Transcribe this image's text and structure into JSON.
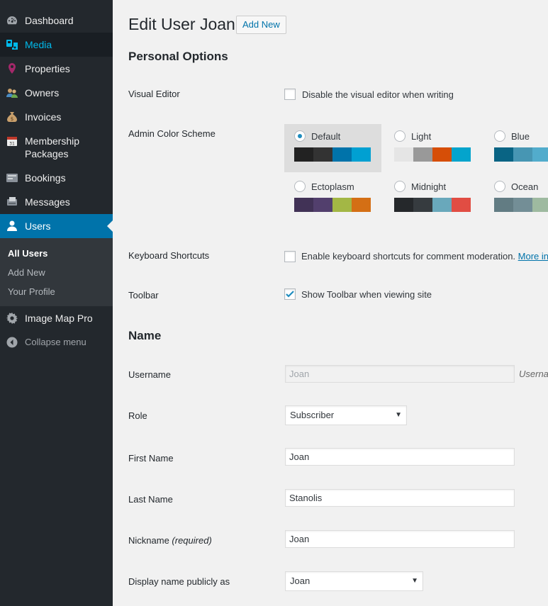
{
  "sidebar": {
    "items": [
      {
        "label": "Dashboard",
        "icon": "dashboard-icon"
      },
      {
        "label": "Media",
        "icon": "media-icon"
      },
      {
        "label": "Properties",
        "icon": "map-pin-icon"
      },
      {
        "label": "Owners",
        "icon": "owners-icon"
      },
      {
        "label": "Invoices",
        "icon": "money-bag-icon"
      },
      {
        "label": "Membership Packages",
        "icon": "calendar-icon"
      },
      {
        "label": "Bookings",
        "icon": "bookings-icon"
      },
      {
        "label": "Messages",
        "icon": "messages-icon"
      },
      {
        "label": "Users",
        "icon": "user-icon"
      }
    ],
    "submenu": [
      "All Users",
      "Add New",
      "Your Profile"
    ],
    "image_map_pro": "Image Map Pro",
    "collapse": "Collapse menu"
  },
  "header": {
    "title": "Edit User Joan",
    "add_new": "Add New"
  },
  "personal_options": {
    "heading": "Personal Options",
    "visual_editor_label": "Visual Editor",
    "visual_editor_checkbox": "Disable the visual editor when writing",
    "color_scheme_label": "Admin Color Scheme",
    "schemes": [
      {
        "name": "Default",
        "selected": true,
        "colors": [
          "#222222",
          "#333333",
          "#0073aa",
          "#00a0d2"
        ]
      },
      {
        "name": "Light",
        "selected": false,
        "colors": [
          "#e5e5e5",
          "#999999",
          "#d64e07",
          "#04a4cc"
        ]
      },
      {
        "name": "Blue",
        "selected": false,
        "colors": [
          "#096484",
          "#4796b3",
          "#52accc",
          "#74B6CE"
        ]
      },
      {
        "name": "Ectoplasm",
        "selected": false,
        "colors": [
          "#413256",
          "#523f6d",
          "#a3b745",
          "#d46f15"
        ]
      },
      {
        "name": "Midnight",
        "selected": false,
        "colors": [
          "#25282b",
          "#363b3f",
          "#69a8bb",
          "#e14d43"
        ]
      },
      {
        "name": "Ocean",
        "selected": false,
        "colors": [
          "#627c83",
          "#738e96",
          "#9ebaa0",
          "#aa9d88"
        ]
      }
    ],
    "keyboard_label": "Keyboard Shortcuts",
    "keyboard_checkbox": "Enable keyboard shortcuts for comment moderation.",
    "keyboard_more": "More in",
    "toolbar_label": "Toolbar",
    "toolbar_checkbox": "Show Toolbar when viewing site"
  },
  "name_section": {
    "heading": "Name",
    "username_label": "Username",
    "username_value": "Joan",
    "username_desc": "Userna",
    "role_label": "Role",
    "role_value": "Subscriber",
    "first_name_label": "First Name",
    "first_name_value": "Joan",
    "last_name_label": "Last Name",
    "last_name_value": "Stanolis",
    "nickname_label": "Nickname",
    "nickname_required": "(required)",
    "nickname_value": "Joan",
    "display_name_label": "Display name publicly as",
    "display_name_value": "Joan"
  },
  "colors": {
    "sidebar_bg": "#23282d",
    "submenu_bg": "#32373c",
    "accent": "#0073aa",
    "media_hover": "#00b9eb"
  }
}
